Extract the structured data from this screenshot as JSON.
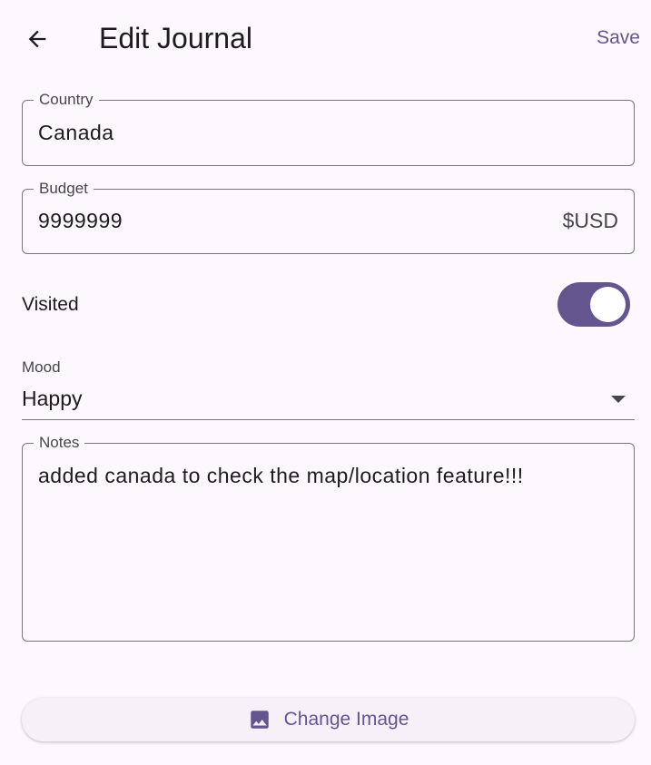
{
  "appbar": {
    "title": "Edit Journal",
    "back_icon": "arrow-back-icon",
    "save_label": "Save"
  },
  "form": {
    "country": {
      "label": "Country",
      "value": "Canada"
    },
    "budget": {
      "label": "Budget",
      "value": "9999999",
      "suffix": "$USD"
    },
    "visited": {
      "label": "Visited",
      "on": true
    },
    "mood": {
      "label": "Mood",
      "value": "Happy",
      "caret_icon": "dropdown-arrow-icon"
    },
    "notes": {
      "label": "Notes",
      "value": "added canada to check the map/location feature!!!"
    }
  },
  "actions": {
    "change_image_label": "Change Image",
    "change_image_icon": "image-icon"
  },
  "colors": {
    "background": "#fdf7fe",
    "accent": "#65558f",
    "outline": "#79747e",
    "text": "#1d1b20",
    "muted": "#49454f"
  }
}
